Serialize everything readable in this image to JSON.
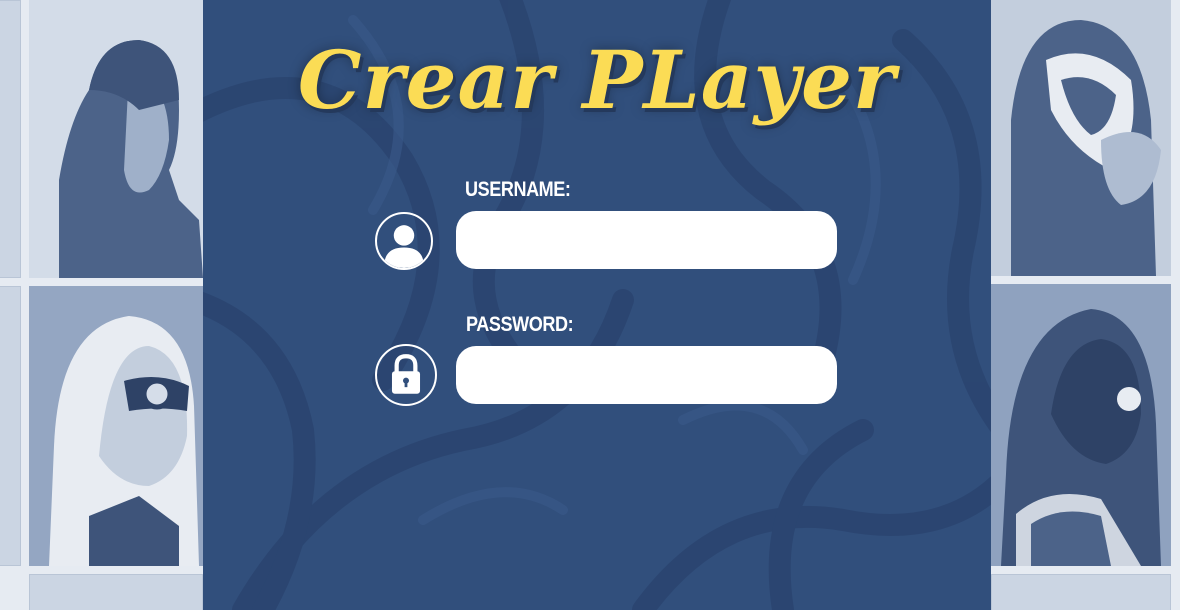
{
  "page": {
    "title": "Crear PLayer"
  },
  "form": {
    "username": {
      "label": "USERNAME:",
      "value": "",
      "icon": "user-avatar-icon"
    },
    "password": {
      "label": "PASSWORD:",
      "value": "",
      "icon": "padlock-icon"
    }
  },
  "colors": {
    "panel_background": "#314f7c",
    "title": "#fbdc55",
    "input_background": "#ffffff",
    "side_tiles": "#cbd5e3"
  }
}
